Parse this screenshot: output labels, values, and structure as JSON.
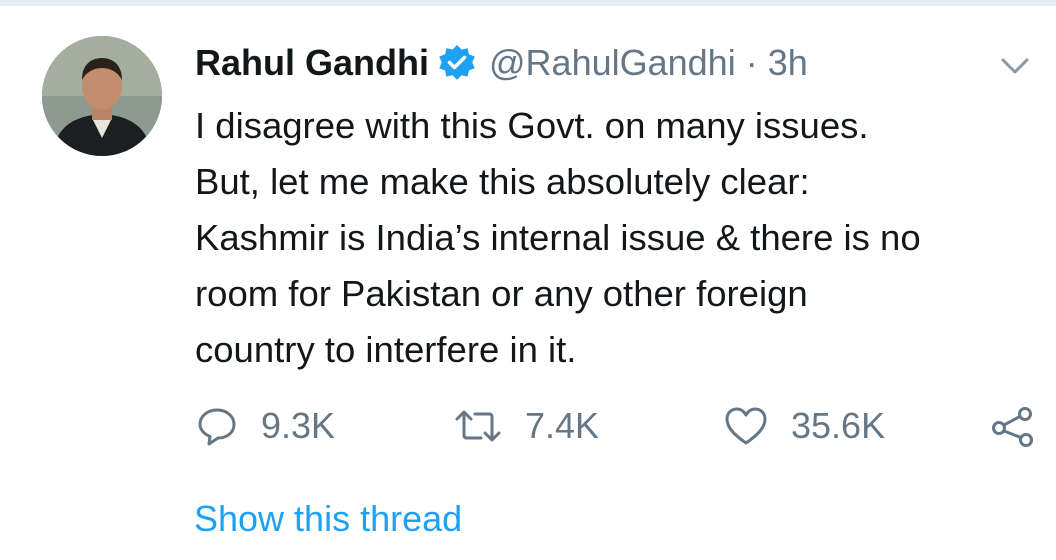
{
  "tweet": {
    "author_name": "Rahul Gandhi",
    "handle": "@RahulGandhi",
    "separator": "·",
    "time_ago": "3h",
    "verified": true,
    "text_lines": [
      "I disagree with this Govt. on many issues.",
      "But, let me make this absolutely clear:",
      "Kashmir is India’s internal issue & there is no",
      "room for Pakistan or any other foreign",
      "country to interfere in it."
    ]
  },
  "actions": {
    "replies": "9.3K",
    "retweets": "7.4K",
    "likes": "35.6K"
  },
  "thread_link": "Show this thread",
  "icons": {
    "verified": "verified-badge-icon",
    "caret": "chevron-down-icon",
    "reply": "reply-icon",
    "retweet": "retweet-icon",
    "like": "heart-icon",
    "share": "share-icon"
  },
  "colors": {
    "text": "#14171a",
    "muted": "#657786",
    "accent": "#1da1f2"
  }
}
